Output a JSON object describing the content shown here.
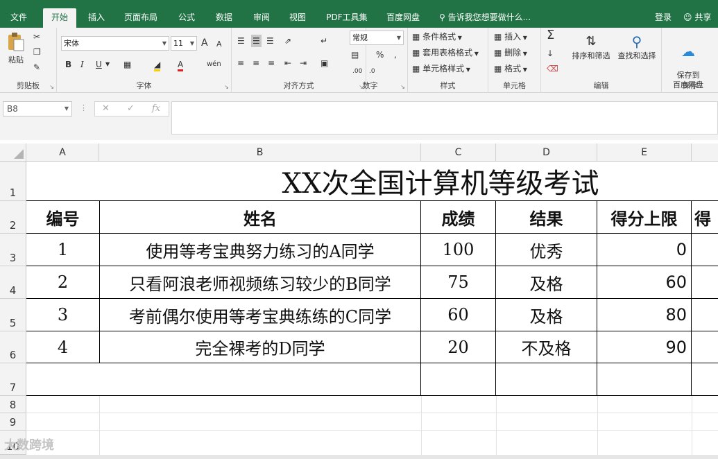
{
  "ribbon_tabs": [
    "文件",
    "开始",
    "插入",
    "页面布局",
    "公式",
    "数据",
    "审阅",
    "视图",
    "PDF工具集",
    "百度网盘"
  ],
  "active_tab": "开始",
  "tell_me": "告诉我您想要做什么...",
  "login": "登录",
  "share": "共享",
  "groups": {
    "clipboard": {
      "label": "剪贴板",
      "paste": "粘贴"
    },
    "font": {
      "label": "字体",
      "family": "宋体",
      "size": "11",
      "bold": "B",
      "italic": "I",
      "underline": "U",
      "grow": "A",
      "shrink": "A",
      "phonetic": "wén"
    },
    "alignment": {
      "label": "对齐方式"
    },
    "number": {
      "label": "数字",
      "format": "常规",
      "percent": "%",
      "comma": ","
    },
    "styles": {
      "label": "样式",
      "conditional": "条件格式",
      "table": "套用表格格式",
      "cell": "单元格样式"
    },
    "cells": {
      "label": "单元格",
      "insert": "插入",
      "delete": "删除",
      "format": "格式"
    },
    "editing": {
      "label": "编辑",
      "sort": "排序和筛选",
      "find": "查找和选择"
    },
    "save": {
      "label": "保存",
      "button": "保存到\n百度网盘"
    }
  },
  "name_box": "B8",
  "formula": "",
  "columns": [
    "A",
    "B",
    "C",
    "D",
    "E"
  ],
  "rows": [
    "1",
    "2",
    "3",
    "4",
    "5",
    "6",
    "7",
    "8",
    "9",
    "10"
  ],
  "sheet": {
    "title": "XX次全国计算机等级考试",
    "headers": [
      "编号",
      "姓名",
      "成绩",
      "结果",
      "得分上限",
      "得"
    ],
    "records": [
      [
        "1",
        "使用等考宝典努力练习的A同学",
        "100",
        "优秀",
        "0"
      ],
      [
        "2",
        "只看阿浪老师视频练习较少的B同学",
        "75",
        "及格",
        "60"
      ],
      [
        "3",
        "考前偶尔使用等考宝典练练的C同学",
        "60",
        "及格",
        "80"
      ],
      [
        "4",
        "完全裸考的D同学",
        "20",
        "不及格",
        "90"
      ]
    ]
  },
  "watermark": "大数跨境"
}
